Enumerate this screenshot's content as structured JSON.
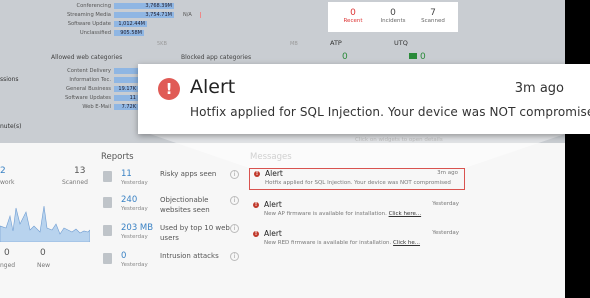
{
  "top_bars": [
    {
      "label": "Conferencing",
      "value": "3,768.39M"
    },
    {
      "label": "Streaming Media",
      "value": "3,754.71M"
    },
    {
      "label": "Software Update",
      "value": "1,012.44M"
    },
    {
      "label": "Unclassified",
      "value": "905.58M"
    }
  ],
  "top_bars_extra": "N/A",
  "axis_labels": [
    "0KB",
    "5KB",
    "MB"
  ],
  "allowed_web_title": "Allowed web categories",
  "blocked_app_title": "Blocked app categories",
  "allowed_web": [
    {
      "label": "Content Delivery",
      "value": ""
    },
    {
      "label": "Information Tec.",
      "value": ""
    },
    {
      "label": "General Business",
      "value": "19.17K"
    },
    {
      "label": "Software Updates",
      "value": "11"
    },
    {
      "label": "Web E-Mail",
      "value": "7.72K"
    }
  ],
  "left_texts": [
    "ssions",
    "nute(s)"
  ],
  "stats": [
    {
      "n": "0",
      "t": "Recent"
    },
    {
      "n": "0",
      "t": "Incidents"
    },
    {
      "n": "7",
      "t": "Scanned"
    }
  ],
  "atp_label": "ATP",
  "utq_label": "UTQ",
  "atp_value": "0",
  "utq_value": "0",
  "click_hint": "Click on widgets to open details",
  "left_panel": {
    "n1": "2",
    "n2": "13",
    "work": "work",
    "scanned": "Scanned",
    "b1": "0",
    "b2": "0",
    "changed": "nged",
    "new": "New"
  },
  "reports_title": "Reports",
  "reports": [
    {
      "value": "11",
      "sub": "Yesterday",
      "desc": "Risky apps seen"
    },
    {
      "value": "240",
      "sub": "Yesterday",
      "desc": "Objectionable websites seen"
    },
    {
      "value": "203 MB",
      "sub": "Yesterday",
      "desc": "Used by top 10 web users"
    },
    {
      "value": "0",
      "sub": "Yesterday",
      "desc": "Intrusion attacks"
    }
  ],
  "messages_title": "Messages",
  "messages": [
    {
      "title": "Alert",
      "time": "3m ago",
      "body": "Hotfix applied for SQL Injection. Your device was NOT compromised",
      "link": ""
    },
    {
      "title": "Alert",
      "time": "Yesterday",
      "body": "New AP firmware is available for installation.",
      "link": "Click here..."
    },
    {
      "title": "Alert",
      "time": "Yesterday",
      "body": "New RED firmware is available for installation.",
      "link": "Click he..."
    }
  ],
  "popup": {
    "title": "Alert",
    "time": "3m ago",
    "body": "Hotfix applied for SQL Injection. Your device was NOT compromised"
  },
  "colors": {
    "alert_red": "#e05b56",
    "link_blue": "#3a82c4",
    "bar_blue": "#8fb6e3"
  },
  "icons": [
    "alert-icon",
    "report-icon",
    "info-icon",
    "chart-icon"
  ]
}
